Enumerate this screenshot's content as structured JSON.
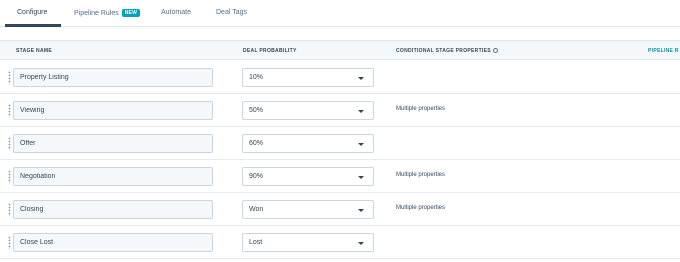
{
  "tabs": [
    {
      "label": "Configure",
      "active": true
    },
    {
      "label": "Pipeline Rules",
      "badge": "NEW"
    },
    {
      "label": "Automate"
    },
    {
      "label": "Deal Tags"
    }
  ],
  "columns": {
    "stage_name": "STAGE NAME",
    "deal_probability": "DEAL PROBABILITY",
    "conditional": "CONDITIONAL STAGE PROPERTIES",
    "pipeline_rules": "PIPELINE R"
  },
  "stages": [
    {
      "name": "Property Listing",
      "probability": "10%",
      "conditional": ""
    },
    {
      "name": "Viewing",
      "probability": "50%",
      "conditional": "Multiple properties"
    },
    {
      "name": "Offer",
      "probability": "60%",
      "conditional": ""
    },
    {
      "name": "Negotiation",
      "probability": "90%",
      "conditional": "Multiple properties"
    },
    {
      "name": "Closing",
      "probability": "Won",
      "conditional": "Multiple properties"
    },
    {
      "name": "Close Lost",
      "probability": "Lost",
      "conditional": ""
    }
  ],
  "colors": {
    "accent": "#00a4bd",
    "link": "#0091ae",
    "text": "#33475b"
  }
}
